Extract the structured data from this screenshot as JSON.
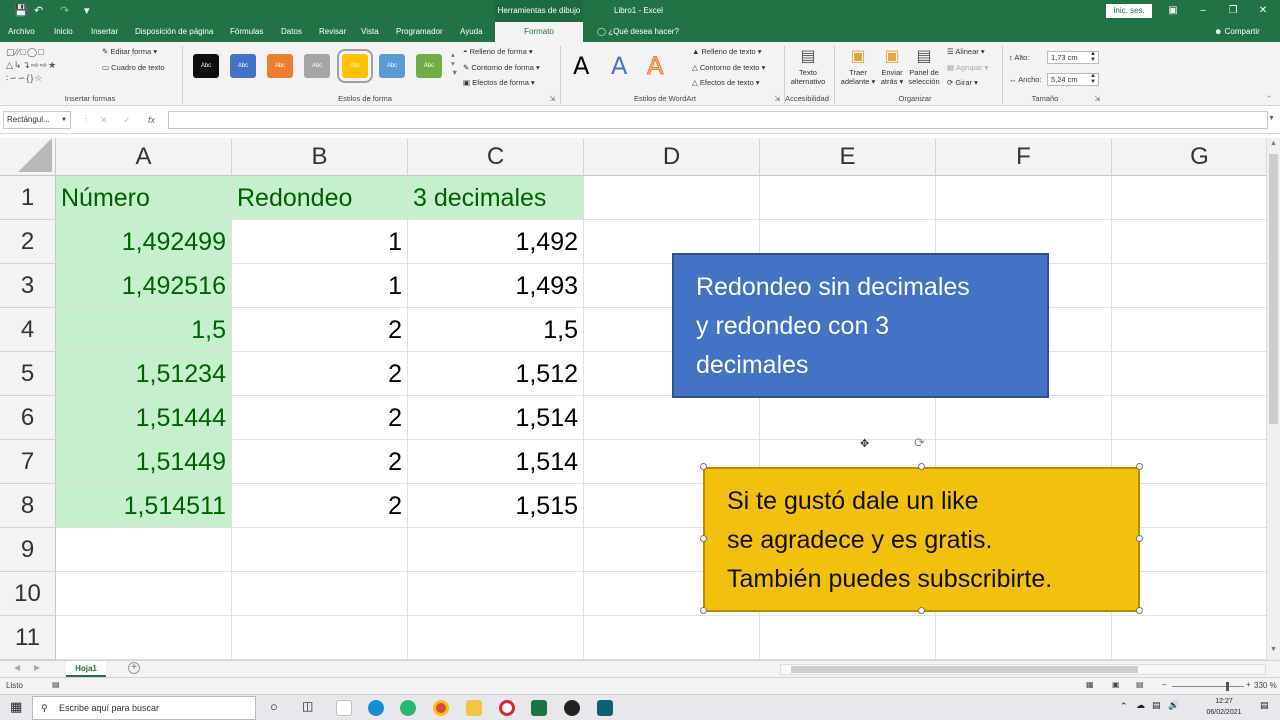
{
  "title_bar": {
    "context_label": "Herramientas de dibujo",
    "title": "Libro1  -  Excel",
    "sign_in": "Inic. ses."
  },
  "tabs": [
    "Archivo",
    "Inicio",
    "Insertar",
    "Disposición de página",
    "Fórmulas",
    "Datos",
    "Revisar",
    "Vista",
    "Programador",
    "Ayuda"
  ],
  "active_tab": "Formato",
  "tell_me": "¿Qué desea hacer?",
  "share": "Compartir",
  "ribbon": {
    "insert_shapes": {
      "edit_shape": "Editar forma",
      "text_box": "Cuadro de texto",
      "label": "Insertar formas"
    },
    "shape_styles": {
      "swatch_text": "Abc",
      "swatch_colors": [
        "#0d0d0d",
        "#4472c4",
        "#ed7d31",
        "#a5a5a5",
        "#ffc000",
        "#5b9bd5",
        "#70ad47"
      ],
      "fill": "Relleno de forma",
      "outline": "Contorno de forma",
      "effects": "Efectos de forma",
      "label": "Estilos de forma"
    },
    "wordart": {
      "letter": "A",
      "text_fill": "Relleno de texto",
      "text_outline": "Contorno de texto",
      "text_effects": "Efectos de texto",
      "label": "Estilos de WordArt"
    },
    "accessibility": {
      "alt_text_1": "Texto",
      "alt_text_2": "alternativo",
      "label": "Accesibilidad"
    },
    "arrange": {
      "bring_forward_1": "Traer",
      "bring_forward_2": "adelante",
      "send_backward_1": "Enviar",
      "send_backward_2": "atrás",
      "selection_pane_1": "Panel de",
      "selection_pane_2": "selección",
      "align": "Alinear",
      "group": "Agrupar",
      "rotate": "Girar",
      "label": "Organizar"
    },
    "size": {
      "height_label": "Alto:",
      "height_value": "1,73 cm",
      "width_label": "Ancho:",
      "width_value": "5,24 cm",
      "label": "Tamaño"
    }
  },
  "formula_bar": {
    "name_box": "Rectángul...",
    "fx": "fx",
    "content": ""
  },
  "columns": [
    "A",
    "B",
    "C",
    "D",
    "E",
    "F",
    "G"
  ],
  "rows": [
    "1",
    "2",
    "3",
    "4",
    "5",
    "6",
    "7",
    "8",
    "9",
    "10",
    "11"
  ],
  "table": {
    "headers": [
      "Número",
      "Redondeo",
      "3 decimales"
    ],
    "rows": [
      [
        "1,492499",
        "1",
        "1,492"
      ],
      [
        "1,492516",
        "1",
        "1,493"
      ],
      [
        "1,5",
        "2",
        "1,5"
      ],
      [
        "1,51234",
        "2",
        "1,512"
      ],
      [
        "1,51444",
        "2",
        "1,514"
      ],
      [
        "1,51449",
        "2",
        "1,514"
      ],
      [
        "1,514511",
        "2",
        "1,515"
      ]
    ]
  },
  "shapes": {
    "blue": {
      "lines": [
        "Redondeo sin decimales",
        "y redondeo con 3",
        "decimales"
      ],
      "color": "#4472c4"
    },
    "yellow": {
      "lines": [
        "Si te gustó dale un like",
        "se agradece y es gratis.",
        "También puedes subscribirte."
      ],
      "color": "#f2c10e"
    }
  },
  "sheet_tab": "Hoja1",
  "status": {
    "ready": "Listo",
    "zoom": "330 %"
  },
  "taskbar": {
    "search_placeholder": "Escribe aquí para buscar",
    "time": "12:27",
    "date": "06/02/2021"
  }
}
